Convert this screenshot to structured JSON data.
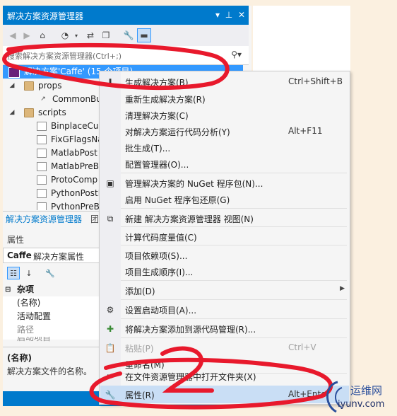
{
  "solution_explorer": {
    "title": "解决方案资源管理器",
    "titlebar_icons": [
      "dropdown-icon",
      "pin-icon",
      "close-icon"
    ],
    "search_placeholder": "搜索解决方案资源管理器(Ctrl+;)",
    "tree": {
      "solution": "解决方案'Caffe' (15 个项目)",
      "props": "props",
      "common_build": "CommonBuild",
      "scripts": "scripts",
      "files": [
        "BinplaceCud",
        "FixGFlagsNa",
        "MatlabPost",
        "MatlabPreB",
        "ProtoComp",
        "PythonPostB",
        "PythonPreB"
      ]
    },
    "tabs": [
      "解决方案资源管理器",
      "团"
    ]
  },
  "properties": {
    "title": "属性",
    "object_name": "Caffe",
    "object_type": "解决方案属性",
    "grid": {
      "category": "杂项",
      "rows": [
        "(名称)",
        "活动配置",
        "路径",
        "启动项目"
      ]
    },
    "description_name": "(名称)",
    "description_text": "解决方案文件的名称。"
  },
  "context_menu": {
    "items": [
      {
        "label": "生成解决方案(B)",
        "shortcut": "Ctrl+Shift+B",
        "icon": "build-icon"
      },
      {
        "label": "重新生成解决方案(R)",
        "shortcut": ""
      },
      {
        "label": "清理解决方案(C)",
        "shortcut": ""
      },
      {
        "label": "对解决方案运行代码分析(Y)",
        "shortcut": "Alt+F11"
      },
      {
        "label": "批生成(T)...",
        "shortcut": ""
      },
      {
        "label": "配置管理器(O)...",
        "shortcut": ""
      },
      {
        "label": "管理解决方案的 NuGet 程序包(N)...",
        "shortcut": "",
        "icon": "nuget-icon"
      },
      {
        "label": "启用 NuGet 程序包还原(G)",
        "shortcut": ""
      },
      {
        "label": "新建 解决方案资源管理器 视图(N)",
        "shortcut": "",
        "icon": "new-view-icon"
      },
      {
        "label": "计算代码度量值(C)",
        "shortcut": ""
      },
      {
        "label": "项目依赖项(S)...",
        "shortcut": ""
      },
      {
        "label": "项目生成顺序(I)...",
        "shortcut": ""
      },
      {
        "label": "添加(D)",
        "shortcut": ""
      },
      {
        "label": "设置启动项目(A)...",
        "shortcut": "",
        "icon": "gear-icon"
      },
      {
        "label": "将解决方案添加到源代码管理(R)...",
        "shortcut": "",
        "icon": "source-control-icon"
      },
      {
        "label": "粘贴(P)",
        "shortcut": "Ctrl+V",
        "icon": "paste-icon"
      },
      {
        "label": "重命名(M)",
        "shortcut": ""
      },
      {
        "label": "在文件资源管理器中打开文件夹(X)",
        "shortcut": "",
        "icon": "open-folder-icon"
      },
      {
        "label": "属性(R)",
        "shortcut": "Alt+Enter",
        "icon": "wrench-icon"
      }
    ]
  },
  "watermark": {
    "name": "运维网",
    "url": "iyunv.com"
  },
  "colors": {
    "accent": "#007acc",
    "selection": "#3399ff",
    "highlight": "#c9def5",
    "annotation": "#e8192c"
  }
}
